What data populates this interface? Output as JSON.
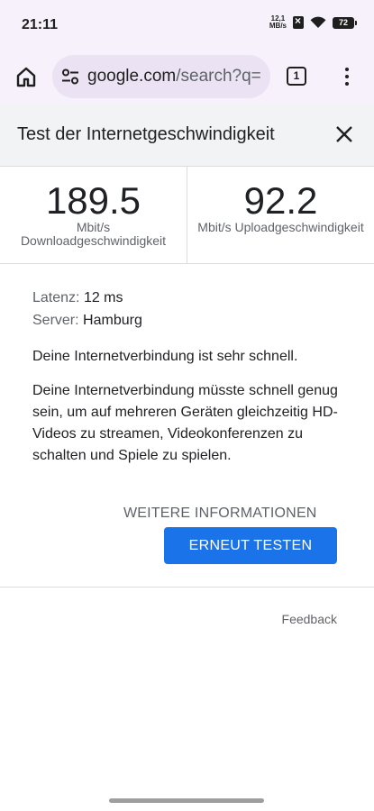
{
  "status_bar": {
    "time": "21:11",
    "net_speed_value": "12,1",
    "net_speed_unit": "MB/s",
    "battery": "72"
  },
  "browser": {
    "url_host": "google.com",
    "url_path": "/search?q=",
    "tab_count": "1"
  },
  "speed_test": {
    "title": "Test der Internetgeschwindigkeit",
    "download": {
      "value": "189.5",
      "unit": "Mbit/s",
      "label": "Downloadgeschwindigkeit"
    },
    "upload": {
      "value": "92.2",
      "unit_label": "Mbit/s Uploadgeschwindigkeit"
    },
    "latency_label": "Latenz:",
    "latency_value": "12 ms",
    "server_label": "Server:",
    "server_value": "Hamburg",
    "summary": "Deine Internetverbindung ist sehr schnell.",
    "description": "Deine Internetverbindung müsste schnell genug sein, um auf mehreren Geräten gleichzeitig HD-Videos zu streamen, Videokonferenzen zu schalten und Spiele zu spielen.",
    "more_info_label": "WEITERE INFORMATIONEN",
    "retest_label": "ERNEUT TESTEN",
    "feedback_label": "Feedback"
  },
  "colors": {
    "accent": "#1a73e8",
    "chrome_bg": "#f6f1fa",
    "header_bg": "#f1f3f4"
  }
}
